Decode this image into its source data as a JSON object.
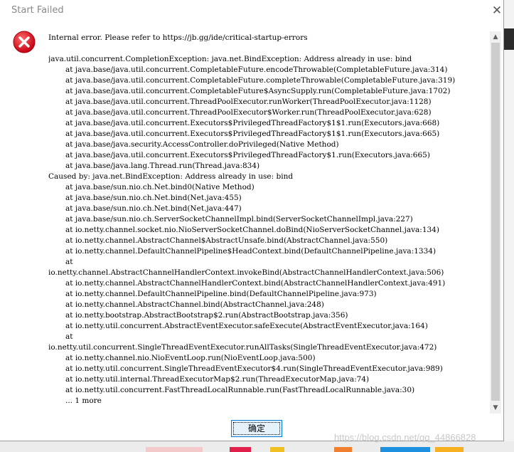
{
  "dialog": {
    "title": "Start Failed",
    "close_symbol": "✕",
    "icon": "error-icon",
    "ok_label": "确定"
  },
  "message": {
    "lines": [
      "Internal error. Please refer to https://jb.gg/ide/critical-startup-errors",
      "",
      "java.util.concurrent.CompletionException: java.net.BindException: Address already in use: bind",
      "\tat java.base/java.util.concurrent.CompletableFuture.encodeThrowable(CompletableFuture.java:314)",
      "\tat java.base/java.util.concurrent.CompletableFuture.completeThrowable(CompletableFuture.java:319)",
      "\tat java.base/java.util.concurrent.CompletableFuture$AsyncSupply.run(CompletableFuture.java:1702)",
      "\tat java.base/java.util.concurrent.ThreadPoolExecutor.runWorker(ThreadPoolExecutor.java:1128)",
      "\tat java.base/java.util.concurrent.ThreadPoolExecutor$Worker.run(ThreadPoolExecutor.java:628)",
      "\tat java.base/java.util.concurrent.Executors$PrivilegedThreadFactory$1$1.run(Executors.java:668)",
      "\tat java.base/java.util.concurrent.Executors$PrivilegedThreadFactory$1$1.run(Executors.java:665)",
      "\tat java.base/java.security.AccessController.doPrivileged(Native Method)",
      "\tat java.base/java.util.concurrent.Executors$PrivilegedThreadFactory$1.run(Executors.java:665)",
      "\tat java.base/java.lang.Thread.run(Thread.java:834)",
      "Caused by: java.net.BindException: Address already in use: bind",
      "\tat java.base/sun.nio.ch.Net.bind0(Native Method)",
      "\tat java.base/sun.nio.ch.Net.bind(Net.java:455)",
      "\tat java.base/sun.nio.ch.Net.bind(Net.java:447)",
      "\tat java.base/sun.nio.ch.ServerSocketChannelImpl.bind(ServerSocketChannelImpl.java:227)",
      "\tat io.netty.channel.socket.nio.NioServerSocketChannel.doBind(NioServerSocketChannel.java:134)",
      "\tat io.netty.channel.AbstractChannel$AbstractUnsafe.bind(AbstractChannel.java:550)",
      "\tat io.netty.channel.DefaultChannelPipeline$HeadContext.bind(DefaultChannelPipeline.java:1334)",
      "\tat",
      "io.netty.channel.AbstractChannelHandlerContext.invokeBind(AbstractChannelHandlerContext.java:506)",
      "\tat io.netty.channel.AbstractChannelHandlerContext.bind(AbstractChannelHandlerContext.java:491)",
      "\tat io.netty.channel.DefaultChannelPipeline.bind(DefaultChannelPipeline.java:973)",
      "\tat io.netty.channel.AbstractChannel.bind(AbstractChannel.java:248)",
      "\tat io.netty.bootstrap.AbstractBootstrap$2.run(AbstractBootstrap.java:356)",
      "\tat io.netty.util.concurrent.AbstractEventExecutor.safeExecute(AbstractEventExecutor.java:164)",
      "\tat",
      "io.netty.util.concurrent.SingleThreadEventExecutor.runAllTasks(SingleThreadEventExecutor.java:472)",
      "\tat io.netty.channel.nio.NioEventLoop.run(NioEventLoop.java:500)",
      "\tat io.netty.util.concurrent.SingleThreadEventExecutor$4.run(SingleThreadEventExecutor.java:989)",
      "\tat io.netty.util.internal.ThreadExecutorMap$2.run(ThreadExecutorMap.java:74)",
      "\tat io.netty.util.concurrent.FastThreadLocalRunnable.run(FastThreadLocalRunnable.java:30)",
      "\t... 1 more"
    ]
  },
  "scrollbar": {
    "up_symbol": "▲",
    "down_symbol": "▼"
  },
  "watermark": "https://blog.csdn.net/qq_44866828",
  "colors": {
    "error_red": "#d0021b",
    "button_border": "#0078d7",
    "button_fill": "#e5f1fb"
  }
}
